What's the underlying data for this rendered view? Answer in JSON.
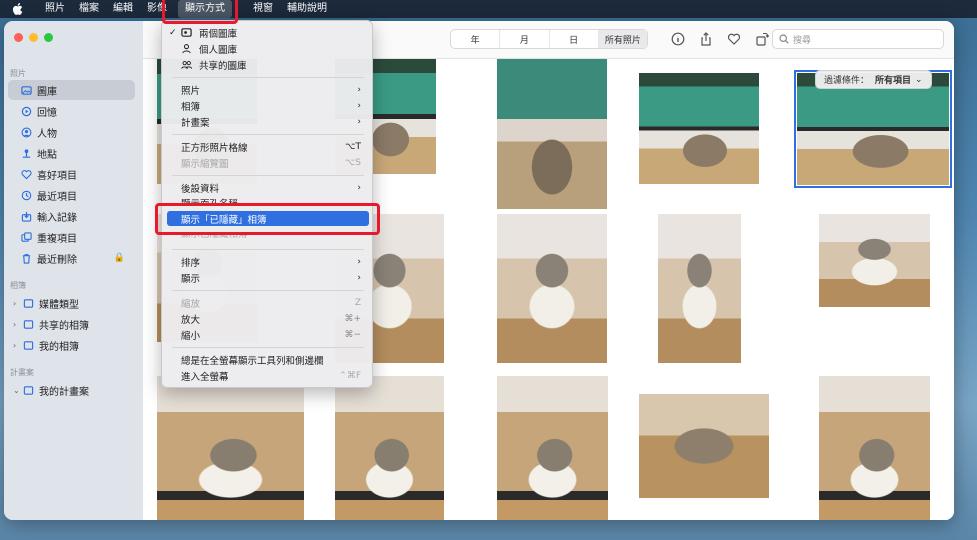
{
  "menubar": {
    "items": [
      "照片",
      "檔案",
      "編輯",
      "影像",
      "顯示方式",
      "視窗",
      "輔助說明"
    ],
    "active_index": 4
  },
  "sidebar": {
    "sections": {
      "photos": "照片",
      "albums": "相簿",
      "projects": "計畫案"
    },
    "photo_items": [
      {
        "label": "圖庫",
        "icon": "library-icon"
      },
      {
        "label": "回憶",
        "icon": "memories-icon"
      },
      {
        "label": "人物",
        "icon": "people-icon"
      },
      {
        "label": "地點",
        "icon": "places-icon"
      },
      {
        "label": "喜好項目",
        "icon": "heart-icon"
      },
      {
        "label": "最近項目",
        "icon": "clock-icon"
      },
      {
        "label": "輸入記錄",
        "icon": "import-icon"
      },
      {
        "label": "重複項目",
        "icon": "duplicates-icon"
      },
      {
        "label": "最近刪除",
        "icon": "trash-icon"
      }
    ],
    "album_items": [
      {
        "label": "媒體類型"
      },
      {
        "label": "共享的相簿"
      },
      {
        "label": "我的相簿"
      }
    ],
    "project_items": [
      {
        "label": "我的計畫案"
      }
    ]
  },
  "toolbar": {
    "segments": [
      "年",
      "月",
      "日",
      "所有照片"
    ],
    "search_placeholder": "搜尋"
  },
  "filter": {
    "label": "過濾條件：",
    "value": "所有項目"
  },
  "view_menu": {
    "libraries": [
      {
        "label": "兩個圖庫",
        "checked": true
      },
      {
        "label": "個人圖庫"
      },
      {
        "label": "共享的圖庫"
      }
    ],
    "nav": [
      {
        "label": "照片"
      },
      {
        "label": "相簿"
      },
      {
        "label": "計畫案"
      }
    ],
    "grid": [
      {
        "label": "正方形照片格線",
        "shortcut": "⌥T"
      },
      {
        "label": "顯示縮覽圖",
        "shortcut": "⌥S"
      }
    ],
    "meta": [
      {
        "label": "後設資料"
      },
      {
        "label": "顯示面孔名稱"
      }
    ],
    "hidden": {
      "label": "顯示「已隱藏」相簿",
      "covered": "顯示已隱藏相簿"
    },
    "sort": [
      {
        "label": "排序"
      },
      {
        "label": "顯示"
      }
    ],
    "zoom": [
      {
        "label": "縮放",
        "shortcut": "Z"
      },
      {
        "label": "放大",
        "shortcut": "⌘+"
      },
      {
        "label": "縮小",
        "shortcut": "⌘−"
      }
    ],
    "full": [
      {
        "label": "總是在全螢幕顯示工具列和側邊欄"
      },
      {
        "label": "進入全螢幕",
        "shortcut": "⌃⌘F"
      }
    ]
  },
  "colors": {
    "accent": "#2f6fe0",
    "highlight_box": "#e8192c"
  }
}
